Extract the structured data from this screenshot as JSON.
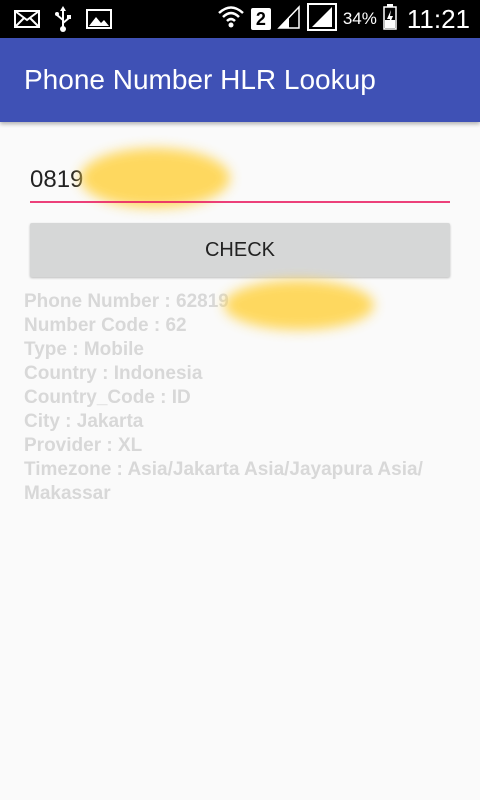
{
  "status_bar": {
    "icons": [
      "mail-icon",
      "usb-icon",
      "image-icon",
      "wifi-icon",
      "sim-icon",
      "signal-icon",
      "signal-icon",
      "battery-icon"
    ],
    "sim_label": "2",
    "battery": "34%",
    "time": "11:21"
  },
  "app_bar": {
    "title": "Phone Number HLR Lookup",
    "color": "#3f51b5"
  },
  "phone_input": {
    "value": "0819"
  },
  "check_button": {
    "label": "CHECK"
  },
  "result": {
    "phone_number": "Phone Number : 62819",
    "number_code": "Number Code : 62",
    "type": "Type : Mobile",
    "country": "Country : Indonesia",
    "country_code": "Country_Code : ID",
    "city": "City : Jakarta",
    "provider": "Provider : XL",
    "timezone": "Timezone : Asia/Jakarta Asia/Jayapura Asia/ Makassar"
  },
  "colors": {
    "accent": "#e91e63",
    "result_text": "#d8d8d8",
    "redaction": "#ffd54f"
  }
}
